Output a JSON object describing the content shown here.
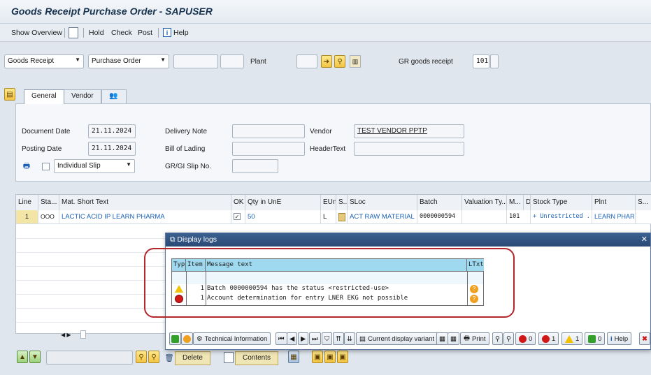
{
  "window": {
    "title": "Goods Receipt Purchase Order - SAPUSER"
  },
  "toolbar": {
    "show_overview": "Show Overview",
    "hold": "Hold",
    "check": "Check",
    "post": "Post",
    "help": "Help"
  },
  "header": {
    "transaction": "Goods Receipt",
    "reference": "Purchase Order",
    "plant_label": "Plant",
    "gr_label": "GR goods receipt",
    "movement_type": "101"
  },
  "tabs": {
    "general": "General",
    "vendor": "Vendor"
  },
  "general": {
    "document_date_label": "Document Date",
    "document_date": "21.11.2024",
    "posting_date_label": "Posting Date",
    "posting_date": "21.11.2024",
    "delivery_note_label": "Delivery Note",
    "bill_of_lading_label": "Bill of Lading",
    "gr_gi_slip_label": "GR/GI Slip No.",
    "vendor_label": "Vendor",
    "vendor_value": "TEST VENDOR PPTP",
    "header_text_label": "HeaderText",
    "slip_option": "Individual Slip"
  },
  "grid": {
    "columns": [
      "Line",
      "Sta...",
      "Mat. Short Text",
      "OK",
      "Qty in UnE",
      "EUn",
      "S..",
      "SLoc",
      "Batch",
      "Valuation Ty...",
      "M...",
      "D",
      "Stock Type",
      "Plnt",
      "S..."
    ],
    "row": {
      "line": "1",
      "status": "OOO",
      "material": "LACTIC ACID IP LEARN PHARMA",
      "qty": "50",
      "eun": "L",
      "sloc": "ACT RAW MATERIAL",
      "batch": "0000000594",
      "movement": "101",
      "stock_type": "+ Unrestricted ..",
      "plant": "LEARN PHAR.."
    }
  },
  "dialog": {
    "title": "Display logs",
    "columns": {
      "typ": "Typ",
      "item": "Item",
      "message": "Message text",
      "ltxt": "LTxt"
    },
    "messages": [
      {
        "type": "warning",
        "item": "1",
        "text": "Batch 0000000594 has the status <restricted-use>"
      },
      {
        "type": "error",
        "item": "1",
        "text": "Account determination for entry LNER EKG not possible"
      }
    ],
    "buttons": {
      "technical_info": "Technical Information",
      "current_variant": "Current display variant",
      "print": "Print",
      "count_stop": "0",
      "count_error": "1",
      "count_warning": "1",
      "count_success": "0",
      "help": "Help"
    }
  },
  "bottom": {
    "delete": "Delete",
    "contents": "Contents"
  },
  "colors": {
    "accent": "#2b4a75",
    "warning": "#f2c200",
    "error": "#d01818",
    "success": "#33a02c",
    "highlight_ring": "#b3262b"
  }
}
